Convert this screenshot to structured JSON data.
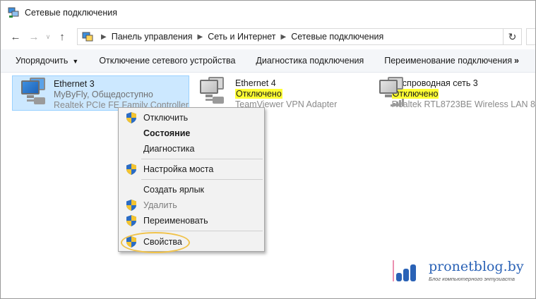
{
  "window": {
    "title": "Сетевые подключения"
  },
  "nav": {
    "back_icon": "arrow-left-icon",
    "forward_icon": "arrow-right-icon",
    "up_icon": "arrow-up-icon",
    "refresh_icon": "refresh-icon",
    "breadcrumb": [
      "Панель управления",
      "Сеть и Интернет",
      "Сетевые подключения"
    ]
  },
  "toolbar": {
    "organize": "Упорядочить",
    "disable_device": "Отключение сетевого устройства",
    "diagnose": "Диагностика подключения",
    "rename": "Переименование подключения",
    "more": "»"
  },
  "connections": [
    {
      "name": "Ethernet 3",
      "status": "MyByFly, Общедоступно",
      "adapter": "Realtek PCIe FE Family Controller",
      "icon": "ethernet-connected-icon"
    },
    {
      "name": "Ethernet 4",
      "status": "Отключено",
      "adapter": "TeamViewer VPN Adapter",
      "icon": "ethernet-disabled-icon"
    },
    {
      "name": "Беспроводная сеть 3",
      "status": "Отключено",
      "adapter": "Realtek RTL8723BE Wireless LAN 8",
      "icon": "wireless-disabled-icon"
    }
  ],
  "context_menu": {
    "items": [
      {
        "label": "Отключить",
        "shield": true
      },
      {
        "label": "Состояние",
        "shield": false
      },
      {
        "label": "Диагностика",
        "shield": false
      },
      {
        "label": "Настройка моста",
        "shield": true
      },
      {
        "label": "Создать ярлык",
        "shield": false
      },
      {
        "label": "Удалить",
        "shield": true
      },
      {
        "label": "Переименовать",
        "shield": true
      },
      {
        "label": "Свойства",
        "shield": true
      }
    ]
  },
  "watermark": {
    "site": "pronetblog.by",
    "tagline": "Блог компьютерного энтузиаста"
  },
  "colors": {
    "selection_bg": "#cce8ff",
    "highlight_yellow": "#ffff33",
    "circle_highlight": "#f0c24a",
    "shield_blue": "#2b6cc4",
    "shield_yellow": "#f4c430",
    "watermark_blue": "#2a62b6",
    "watermark_pink": "#e0467a"
  }
}
